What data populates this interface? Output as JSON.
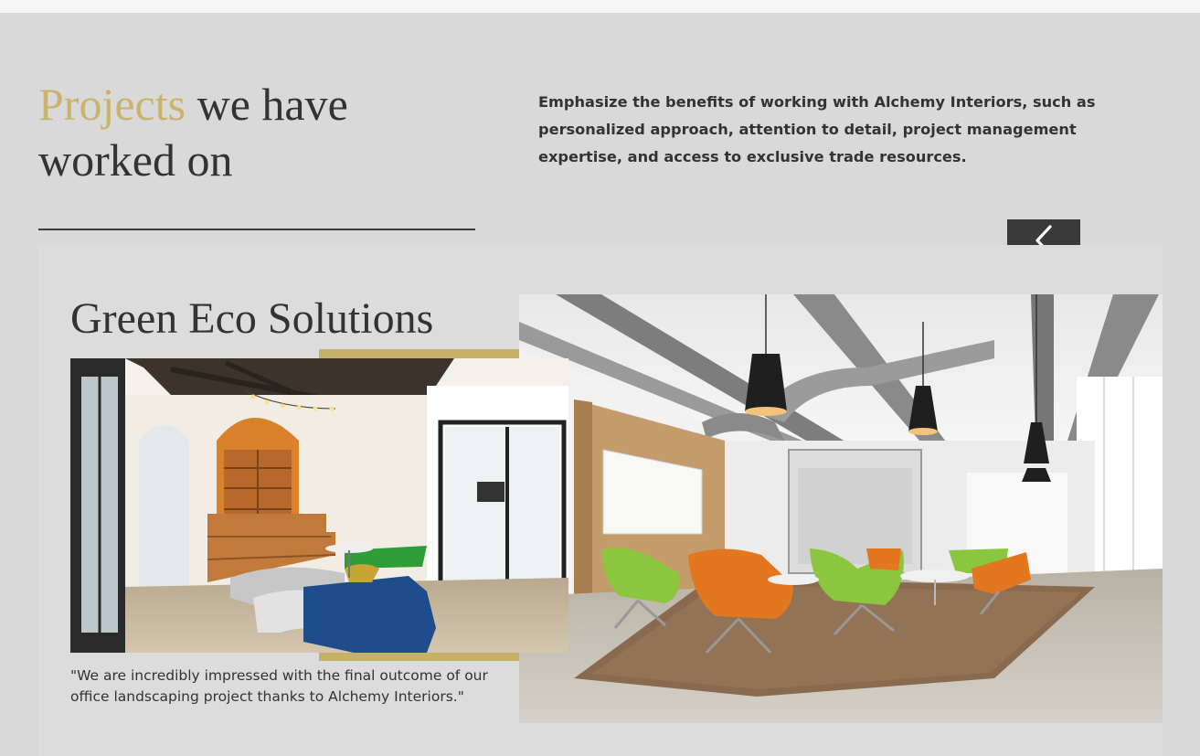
{
  "header": {
    "title_accent": "Projects",
    "title_rest": " we have worked on",
    "intro": "Emphasize the benefits of working with Alchemy Interiors, such as personalized approach, attention to detail, project management expertise, and access to exclusive trade resources."
  },
  "slider": {
    "prev_icon": "chevron-left-icon"
  },
  "project": {
    "title": "Green Eco Solutions",
    "quote": "\"We are incredibly impressed with the final outcome of our office landscaping project thanks to Alchemy Interiors.\""
  },
  "colors": {
    "accent_gold": "#c9b46a",
    "frame_gold": "#c5b266",
    "text_dark": "#333333",
    "button_dark": "#3a3a3a",
    "background": "#d9d9d9"
  }
}
